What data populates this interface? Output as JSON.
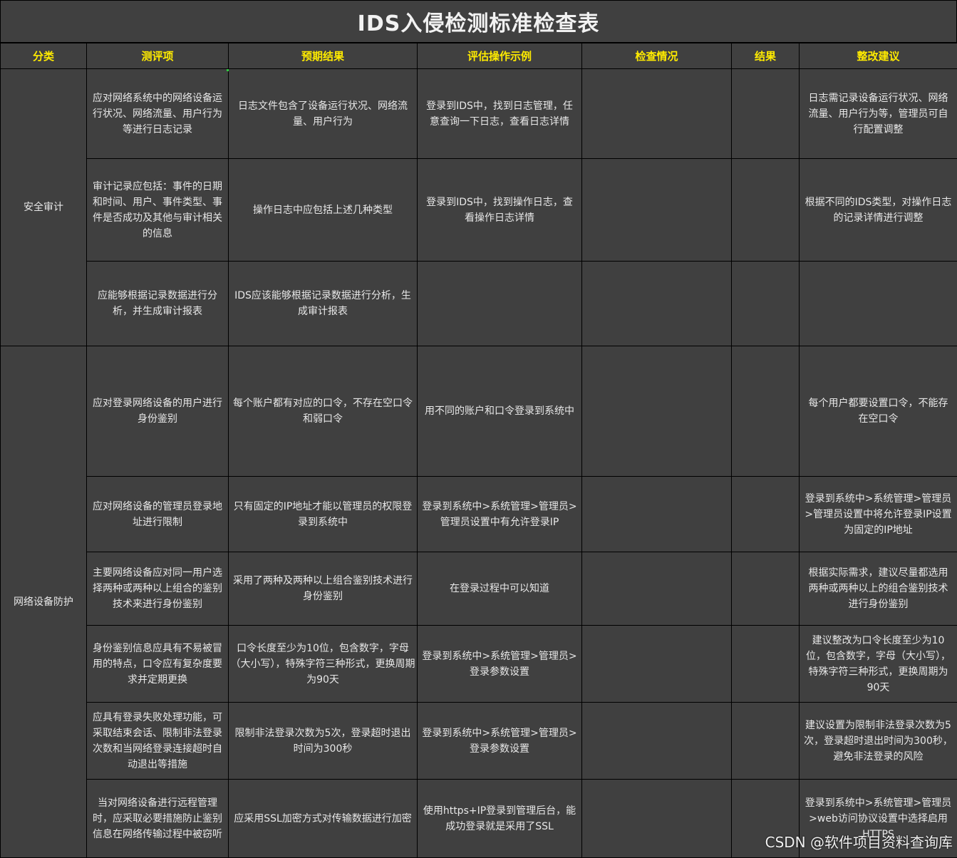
{
  "title": "IDS入侵检测标准检查表",
  "headers": [
    "分类",
    "测评项",
    "预期结果",
    "评估操作示例",
    "检查情况",
    "结果",
    "整改建议"
  ],
  "categories": [
    "安全审计",
    "网络设备防护"
  ],
  "rows": [
    {
      "item": "应对网络系统中的网络设备运行状况、网络流量、用户行为等进行日志记录",
      "expected": "日志文件包含了设备运行状况、网络流量、用户行为",
      "operation": "登录到IDS中，找到日志管理，任意查询一下日志，查看日志详情",
      "check": "",
      "result": "",
      "suggestion": "日志需记录设备运行状况、网络流量、用户行为等，管理员可自行配置调整"
    },
    {
      "item": "审计记录应包括：事件的日期和时间、用户、事件类型、事件是否成功及其他与审计相关的信息",
      "expected": "操作日志中应包括上述几种类型",
      "operation": "登录到IDS中，找到操作日志，查看操作日志详情",
      "check": "",
      "result": "",
      "suggestion": "根据不同的IDS类型，对操作日志的记录详情进行调整"
    },
    {
      "item": "应能够根据记录数据进行分析，并生成审计报表",
      "expected": "IDS应该能够根据记录数据进行分析，生成审计报表",
      "operation": "",
      "check": "",
      "result": "",
      "suggestion": ""
    },
    {
      "item": "应对登录网络设备的用户进行身份鉴别",
      "expected": "每个账户都有对应的口令，不存在空口令和弱口令",
      "operation": "用不同的账户和口令登录到系统中",
      "check": "",
      "result": "",
      "suggestion": "每个用户都要设置口令，不能存在空口令"
    },
    {
      "item": "应对网络设备的管理员登录地址进行限制",
      "expected": "只有固定的IP地址才能以管理员的权限登录到系统中",
      "operation": "登录到系统中>系统管理>管理员>管理员设置中有允许登录IP",
      "check": "",
      "result": "",
      "suggestion": "登录到系统中>系统管理>管理员>管理员设置中将允许登录IP设置为固定的IP地址"
    },
    {
      "item": "主要网络设备应对同一用户选择两种或两种以上组合的鉴别技术来进行身份鉴别",
      "expected": "采用了两种及两种以上组合鉴别技术进行身份鉴别",
      "operation": "在登录过程中可以知道",
      "check": "",
      "result": "",
      "suggestion": "根据实际需求，建议尽量都选用两种或两种以上的组合鉴别技术进行身份鉴别"
    },
    {
      "item": "身份鉴别信息应具有不易被冒用的特点，口令应有复杂度要求并定期更换",
      "expected": "口令长度至少为10位，包含数字，字母（大小写），特殊字符三种形式，更换周期为90天",
      "operation": "登录到系统中>系统管理>管理员>登录参数设置",
      "check": "",
      "result": "",
      "suggestion": "建议整改为口令长度至少为10位，包含数字，字母（大小写），特殊字符三种形式，更换周期为90天"
    },
    {
      "item": "应具有登录失败处理功能，可采取结束会话、限制非法登录次数和当网络登录连接超时自动退出等措施",
      "expected": "限制非法登录次数为5次，登录超时退出时间为300秒",
      "operation": "登录到系统中>系统管理>管理员>登录参数设置",
      "check": "",
      "result": "",
      "suggestion": "建议设置为限制非法登录次数为5次，登录超时退出时间为300秒，避免非法登录的风险"
    },
    {
      "item": "当对网络设备进行远程管理时，应采取必要措施防止鉴别信息在网络传输过程中被窃听",
      "expected": "应采用SSL加密方式对传输数据进行加密",
      "operation": "使用https+IP登录到管理后台，能成功登录就是采用了SSL",
      "check": "",
      "result": "",
      "suggestion": "登录到系统中>系统管理>管理员>web访问协议设置中选择启用HTTPS"
    }
  ],
  "watermark": "CSDN @软件项目资料查询库"
}
